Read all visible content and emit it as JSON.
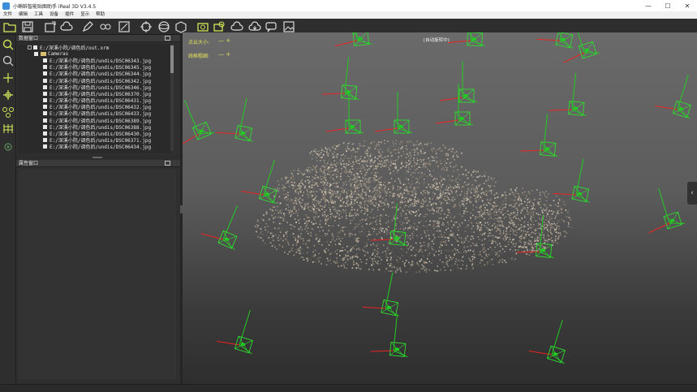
{
  "window": {
    "title": "小蝌蚪智能贴图助手 iReal 3D V3.4.5",
    "minimize": "—",
    "maximize": "☐",
    "close": "✕"
  },
  "menu": {
    "items": [
      "文件",
      "编辑",
      "工具",
      "设备",
      "插件",
      "显示",
      "帮助"
    ]
  },
  "toolbar": {
    "icons": [
      "open-folder-icon",
      "save-icon",
      "import-icon",
      "cloud-icon",
      "edit-icon",
      "bulb-icon",
      "link-icon",
      "measure-icon",
      "texture-icon",
      "target-icon",
      "sphere-icon",
      "package-icon",
      "camera-group-icon",
      "photo-group-icon",
      "cloud-outline-icon",
      "cloud-download-icon",
      "chat-icon",
      "gallery-icon"
    ],
    "accent": "#d8e85a"
  },
  "leftbar": {
    "icons": [
      "search-icon",
      "zoom-icon",
      "crosshair-icon",
      "align-icon",
      "network-icon",
      "grid-icon",
      "record-icon"
    ]
  },
  "data_panel": {
    "title": "数据窗口",
    "root": "E:/深溪小院/调色后/out.xrm",
    "cameras_label": "Cameras",
    "files": [
      "E:/深溪小院/调色后/undis/DSC06343.jpg",
      "E:/深溪小院/调色后/undis/DSC06345.jpg",
      "E:/深溪小院/调色后/undis/DSC06344.jpg",
      "E:/深溪小院/调色后/undis/DSC06342.jpg",
      "E:/深溪小院/调色后/undis/DSC06346.jpg",
      "E:/深溪小院/调色后/undis/DSC06370.jpg",
      "E:/深溪小院/调色后/undis/DSC06431.jpg",
      "E:/深溪小院/调色后/undis/DSC06432.jpg",
      "E:/深溪小院/调色后/undis/DSC06433.jpg",
      "E:/深溪小院/调色后/undis/DSC06389.jpg",
      "E:/深溪小院/调色后/undis/DSC06388.jpg",
      "E:/深溪小院/调色后/undis/DSC06430.jpg",
      "E:/深溪小院/调色后/undis/DSC06371.jpg",
      "E:/深溪小院/调色后/undis/DSC06434.jpg"
    ]
  },
  "prop_panel": {
    "title": "属性窗口"
  },
  "viewport": {
    "point_size_label": "点云大小:",
    "point_size_value": "— +",
    "line_width_label": "线框粗细:",
    "line_width_value": "— +",
    "auto_rotate": "[自动旋转中]",
    "side_handle": "‹"
  }
}
